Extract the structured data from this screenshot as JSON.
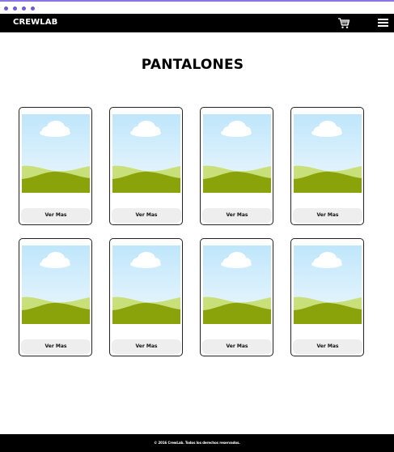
{
  "brand": "CREWLAB",
  "nav": {
    "cart_icon": "shopping-cart-icon",
    "menu_icon": "hamburger-menu-icon"
  },
  "page": {
    "title": "PANTALONES"
  },
  "products": [
    {
      "button": "Ver Mas",
      "image": "landscape-placeholder"
    },
    {
      "button": "Ver Mas",
      "image": "landscape-placeholder"
    },
    {
      "button": "Ver Mas",
      "image": "landscape-placeholder"
    },
    {
      "button": "Ver Mas",
      "image": "landscape-placeholder"
    },
    {
      "button": "Ver Mas",
      "image": "landscape-placeholder"
    },
    {
      "button": "Ver Mas",
      "image": "landscape-placeholder"
    },
    {
      "button": "Ver Mas",
      "image": "landscape-placeholder"
    },
    {
      "button": "Ver Mas",
      "image": "landscape-placeholder"
    }
  ],
  "footer": {
    "copyright": "© 2016 CrewLab. Todos los derechos reservados."
  },
  "colors": {
    "accent": "#8a74e6",
    "navbar": "#000000",
    "sky": "#bfe6fb",
    "hill_front": "#8aa30a",
    "hill_back": "#c8df7a"
  }
}
